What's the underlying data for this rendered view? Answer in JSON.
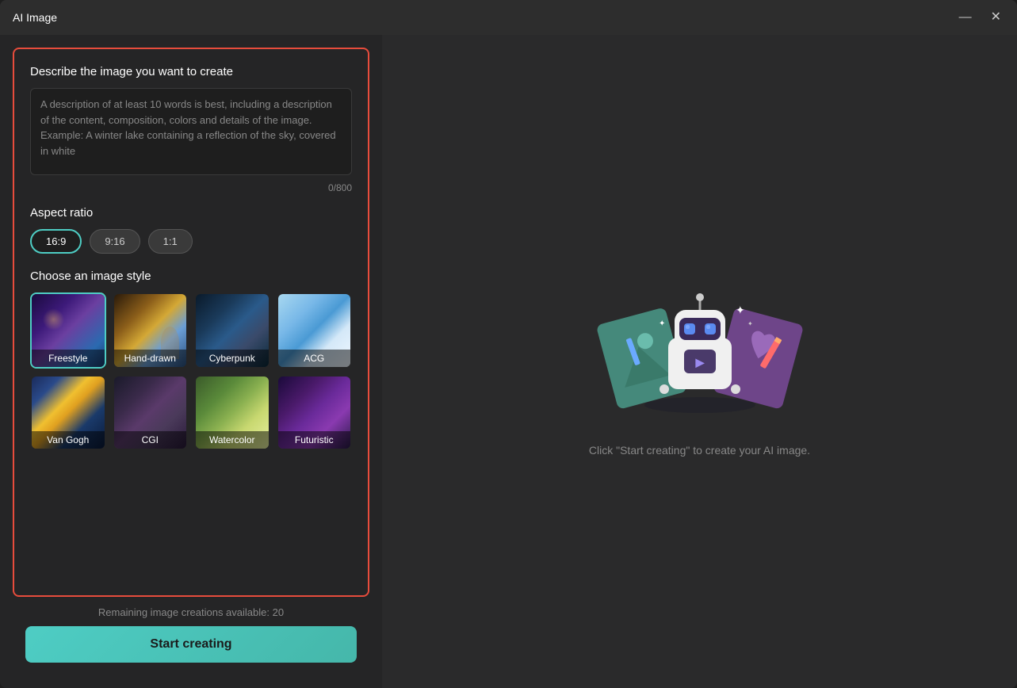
{
  "window": {
    "title": "AI Image",
    "minimize_label": "—",
    "close_label": "✕"
  },
  "left": {
    "describe_label": "Describe the image you want to create",
    "textarea_placeholder": "A description of at least 10 words is best, including a description of the content, composition, colors and details of the image. Example: A winter lake containing a reflection of the sky, covered in white",
    "textarea_value": "",
    "char_count": "0/800",
    "aspect_ratio_label": "Aspect ratio",
    "aspect_ratios": [
      {
        "id": "16_9",
        "label": "16:9",
        "active": true
      },
      {
        "id": "9_16",
        "label": "9:16",
        "active": false
      },
      {
        "id": "1_1",
        "label": "1:1",
        "active": false
      }
    ],
    "style_label": "Choose an image style",
    "styles": [
      {
        "id": "freestyle",
        "label": "Freestyle",
        "selected": true
      },
      {
        "id": "handdrawn",
        "label": "Hand-drawn",
        "selected": false
      },
      {
        "id": "cyberpunk",
        "label": "Cyberpunk",
        "selected": false
      },
      {
        "id": "acg",
        "label": "ACG",
        "selected": false
      },
      {
        "id": "vangogh",
        "label": "Van Gogh",
        "selected": false
      },
      {
        "id": "cgi",
        "label": "CGI",
        "selected": false
      },
      {
        "id": "watercolor",
        "label": "Watercolor",
        "selected": false
      },
      {
        "id": "futuristic",
        "label": "Futuristic",
        "selected": false
      }
    ],
    "remaining_text": "Remaining image creations available: 20",
    "start_btn_label": "Start creating"
  },
  "right": {
    "hint_text": "Click \"Start creating\" to create your AI image."
  }
}
